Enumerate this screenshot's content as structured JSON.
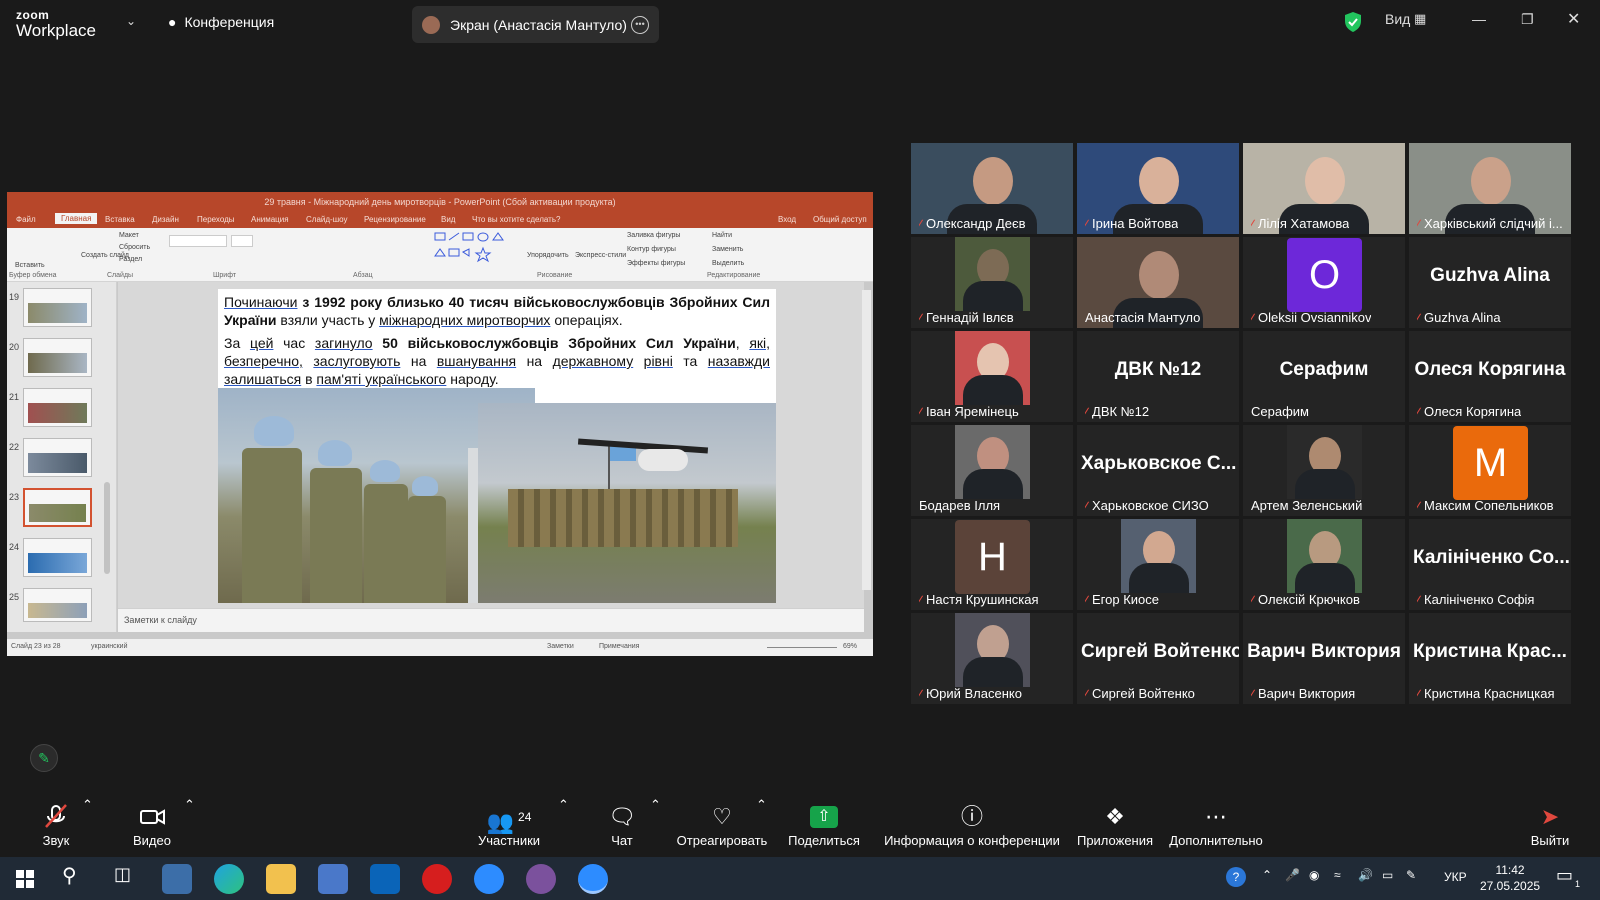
{
  "zoom": {
    "logo_line1": "zoom",
    "logo_line2": "Workplace",
    "conference_label": "Конференция",
    "screen_label": "Экран (Анастасія Мантуло)",
    "view_label": "Вид"
  },
  "ppt": {
    "title": "29 травня - Міжнародний день миротворців - PowerPoint (Сбой активации продукта)",
    "tabs": [
      "Файл",
      "Главная",
      "Вставка",
      "Дизайн",
      "Переходы",
      "Анимация",
      "Слайд-шоу",
      "Рецензирование",
      "Вид",
      "Что вы хотите сделать?"
    ],
    "signin": "Вход",
    "share": "Общий доступ",
    "ribbon_items": {
      "paste": "Вставить",
      "layout": "Макет",
      "reset": "Сбросить",
      "new_slide": "Создать слайд",
      "section": "Раздел",
      "arrange": "Упорядочить",
      "quick_styles": "Экспресс-стили",
      "fill": "Заливка фигуры",
      "outline": "Контур фигуры",
      "effects": "Эффекты фигуры",
      "find": "Найти",
      "replace": "Заменить",
      "select": "Выделить"
    },
    "groups": [
      "Буфер обмена",
      "Слайды",
      "Шрифт",
      "Абзац",
      "Рисование",
      "Редактирование"
    ],
    "thumb_numbers": [
      "19",
      "20",
      "21",
      "22",
      "23",
      "24",
      "25"
    ],
    "slide": {
      "para1": {
        "w1": "Починаючи",
        "b1": "з 1992 року близько 40 тисяч військовослужбовців Збройних Сил України",
        "t1": "взяли участь у",
        "u1": "міжнародних миротворчих",
        "t2": "операціях."
      },
      "para2": {
        "t1": "За",
        "u1": "цей",
        "t2": "час",
        "u2": "загинуло",
        "b1": "50 військовослужбовців Збройних Сил України",
        "t3": ",",
        "u3": "які,",
        "u4": "безперечно,",
        "u5": "заслуговують",
        "t4": "на",
        "u6": "вшанування",
        "t5": "на",
        "u7": "державному",
        "u8": "рівні",
        "t6": "та",
        "u9": "назавжди залишаться",
        "t7": "в",
        "u10": "пам'яті українського",
        "t8": "народу."
      }
    },
    "notes": "Заметки к слайду",
    "status_slide": "Слайд 23 из 28",
    "status_lang": "украинский",
    "status_notes": "Заметки",
    "status_comments": "Примечания",
    "zoom_level": "69%"
  },
  "participants": [
    {
      "name": "Олександр Деєв",
      "kind": "video",
      "muted": true
    },
    {
      "name": "Ірина Войтова",
      "kind": "video",
      "muted": true
    },
    {
      "name": "Лілія Хатамова",
      "kind": "video",
      "muted": true
    },
    {
      "name": "Харківський слідчий і...",
      "kind": "video",
      "muted": true
    },
    {
      "name": "Геннадій Івлєв",
      "kind": "video",
      "muted": true
    },
    {
      "name": "Анастасія Мантуло",
      "kind": "video",
      "muted": false,
      "active": true
    },
    {
      "name": "Oleksii Ovsiannikov",
      "kind": "letter",
      "letter": "O",
      "color": "#6d28d9",
      "muted": true
    },
    {
      "name": "Guzhva Alina",
      "kind": "text",
      "big": "Guzhva Alina",
      "muted": true
    },
    {
      "name": "Іван Яремінець",
      "kind": "video",
      "muted": true
    },
    {
      "name": "ДВК №12",
      "kind": "text",
      "big": "ДВК №12",
      "muted": true
    },
    {
      "name": "Серафим",
      "kind": "text",
      "big": "Серафим",
      "muted": false
    },
    {
      "name": "Олеся Корягина",
      "kind": "text",
      "big": "Олеся Корягина",
      "muted": true
    },
    {
      "name": "Бодарев Ілля",
      "kind": "video",
      "muted": false
    },
    {
      "name": "Харьковское СИЗО",
      "kind": "text",
      "big": "Харьковское С...",
      "muted": true
    },
    {
      "name": "Артем Зеленський",
      "kind": "video",
      "muted": false
    },
    {
      "name": "Максим Сопельников",
      "kind": "letter",
      "letter": "M",
      "color": "#ea6a0c",
      "muted": true
    },
    {
      "name": "Настя Крушинская",
      "kind": "letter",
      "letter": "H",
      "color": "#5b4339",
      "muted": true
    },
    {
      "name": "Егор Киосе",
      "kind": "video",
      "muted": true
    },
    {
      "name": "Олексій Крючков",
      "kind": "video",
      "muted": true
    },
    {
      "name": "Калініченко Софія",
      "kind": "text",
      "big": "Калініченко Со...",
      "muted": true
    },
    {
      "name": "Юрий Власенко",
      "kind": "video",
      "muted": true
    },
    {
      "name": "Сиргей Войтенко",
      "kind": "text",
      "big": "Сиргей Войтенко",
      "muted": true
    },
    {
      "name": "Варич Виктория",
      "kind": "text",
      "big": "Варич Виктория",
      "muted": true
    },
    {
      "name": "Кристина Красницкая",
      "kind": "text",
      "big": "Кристина Крас...",
      "muted": true
    }
  ],
  "toolbar": {
    "audio": "Звук",
    "video": "Видео",
    "participants": "Участники",
    "participants_count": "24",
    "chat": "Чат",
    "react": "Отреагировать",
    "share": "Поделиться",
    "info": "Информация о конференции",
    "apps": "Приложения",
    "more": "Дополнительно",
    "leave": "Выйти"
  },
  "taskbar": {
    "lang": "УКР",
    "time": "11:42",
    "date": "27.05.2025",
    "notif_count": "1"
  },
  "colors": {
    "accent_green": "#22c55e",
    "share_green": "#16a34a",
    "mute_red": "#e0483e",
    "ppt_red": "#b7472a"
  }
}
